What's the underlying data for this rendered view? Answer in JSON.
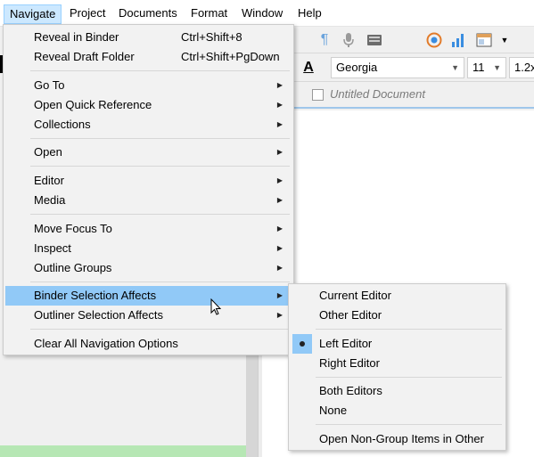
{
  "menubar": [
    "Navigate",
    "Project",
    "Documents",
    "Format",
    "Window",
    "Help"
  ],
  "format_bar": {
    "font": "Georgia",
    "size": "11",
    "line_spacing": "1.2x"
  },
  "header": {
    "doc_title": "Untitled Document"
  },
  "navigate_menu": {
    "reveal_binder": "Reveal in Binder",
    "reveal_binder_shortcut": "Ctrl+Shift+8",
    "reveal_draft": "Reveal Draft Folder",
    "reveal_draft_shortcut": "Ctrl+Shift+PgDown",
    "go_to": "Go To",
    "open_quick_ref": "Open Quick Reference",
    "collections": "Collections",
    "open": "Open",
    "editor": "Editor",
    "media": "Media",
    "move_focus": "Move Focus To",
    "inspect": "Inspect",
    "outline_groups": "Outline Groups",
    "binder_selection": "Binder Selection Affects",
    "outliner_selection": "Outliner Selection Affects",
    "clear_all": "Clear All Navigation Options"
  },
  "binder_submenu": {
    "current_editor": "Current Editor",
    "other_editor": "Other Editor",
    "left_editor": "Left Editor",
    "right_editor": "Right Editor",
    "both_editors": "Both Editors",
    "none": "None",
    "open_non_group": "Open Non-Group Items in Other"
  },
  "colors": {
    "highlight": "#91c9f7",
    "menubar_active": "#cce8ff"
  },
  "icons": [
    "pilcrow-icon",
    "microphone-icon",
    "keyboard-icon",
    "target-icon",
    "bar-chart-icon",
    "layout-icon",
    "text-color-icon"
  ]
}
